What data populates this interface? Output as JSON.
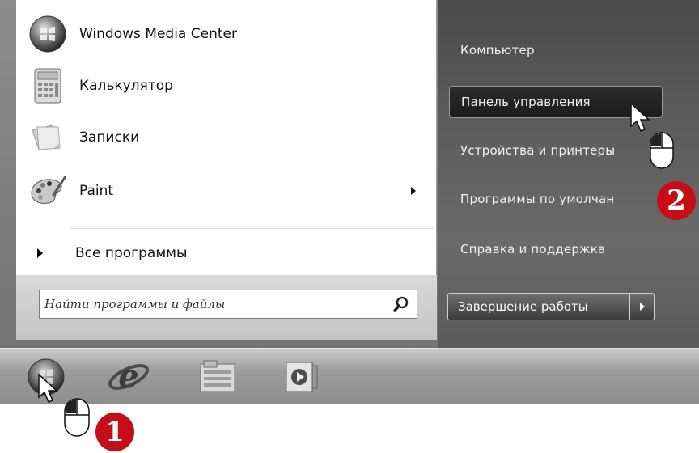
{
  "start_menu": {
    "programs": [
      {
        "label": "Windows Media Center",
        "icon": "windows-media-center-icon"
      },
      {
        "label": "Калькулятор",
        "icon": "calculator-icon"
      },
      {
        "label": "Записки",
        "icon": "sticky-notes-icon"
      },
      {
        "label": "Paint",
        "icon": "paint-palette-icon",
        "has_submenu": true
      }
    ],
    "all_programs_label": "Все программы",
    "search": {
      "placeholder": "Найти программы и файлы",
      "icon": "search-magnifier-icon"
    },
    "right_links": [
      {
        "label": "Компьютер"
      },
      {
        "label": "Панель управления",
        "active": true
      },
      {
        "label": "Устройства и принтеры"
      },
      {
        "label": "Программы по умолчан"
      },
      {
        "label": "Справка и поддержка"
      }
    ],
    "shutdown_label": "Завершение работы"
  },
  "taskbar": {
    "icons": [
      "start-orb-icon",
      "internet-explorer-icon",
      "file-explorer-icon",
      "media-player-icon"
    ]
  },
  "callouts": {
    "step1": "1",
    "step2": "2",
    "color": "#c60d17"
  }
}
